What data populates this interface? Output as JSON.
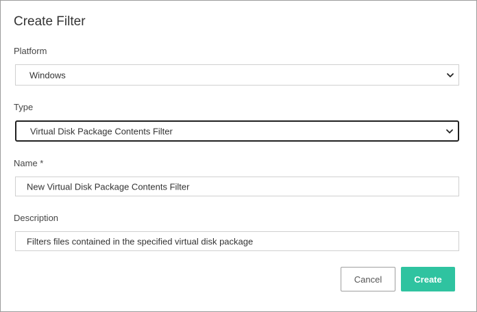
{
  "dialog": {
    "title": "Create Filter"
  },
  "platform": {
    "label": "Platform",
    "selected": "Windows",
    "icon": "chevron-down-icon"
  },
  "type": {
    "label": "Type",
    "selected": "Virtual Disk Package Contents Filter",
    "icon": "chevron-down-icon"
  },
  "name": {
    "label": "Name *",
    "value": "New Virtual Disk Package Contents Filter"
  },
  "description": {
    "label": "Description",
    "value": "Filters files contained in the specified virtual disk package"
  },
  "buttons": {
    "cancel_label": "Cancel",
    "create_label": "Create"
  },
  "colors": {
    "accent": "#2fc3a0",
    "border": "#cfcfcf",
    "focus_border": "#1f1f1f"
  }
}
